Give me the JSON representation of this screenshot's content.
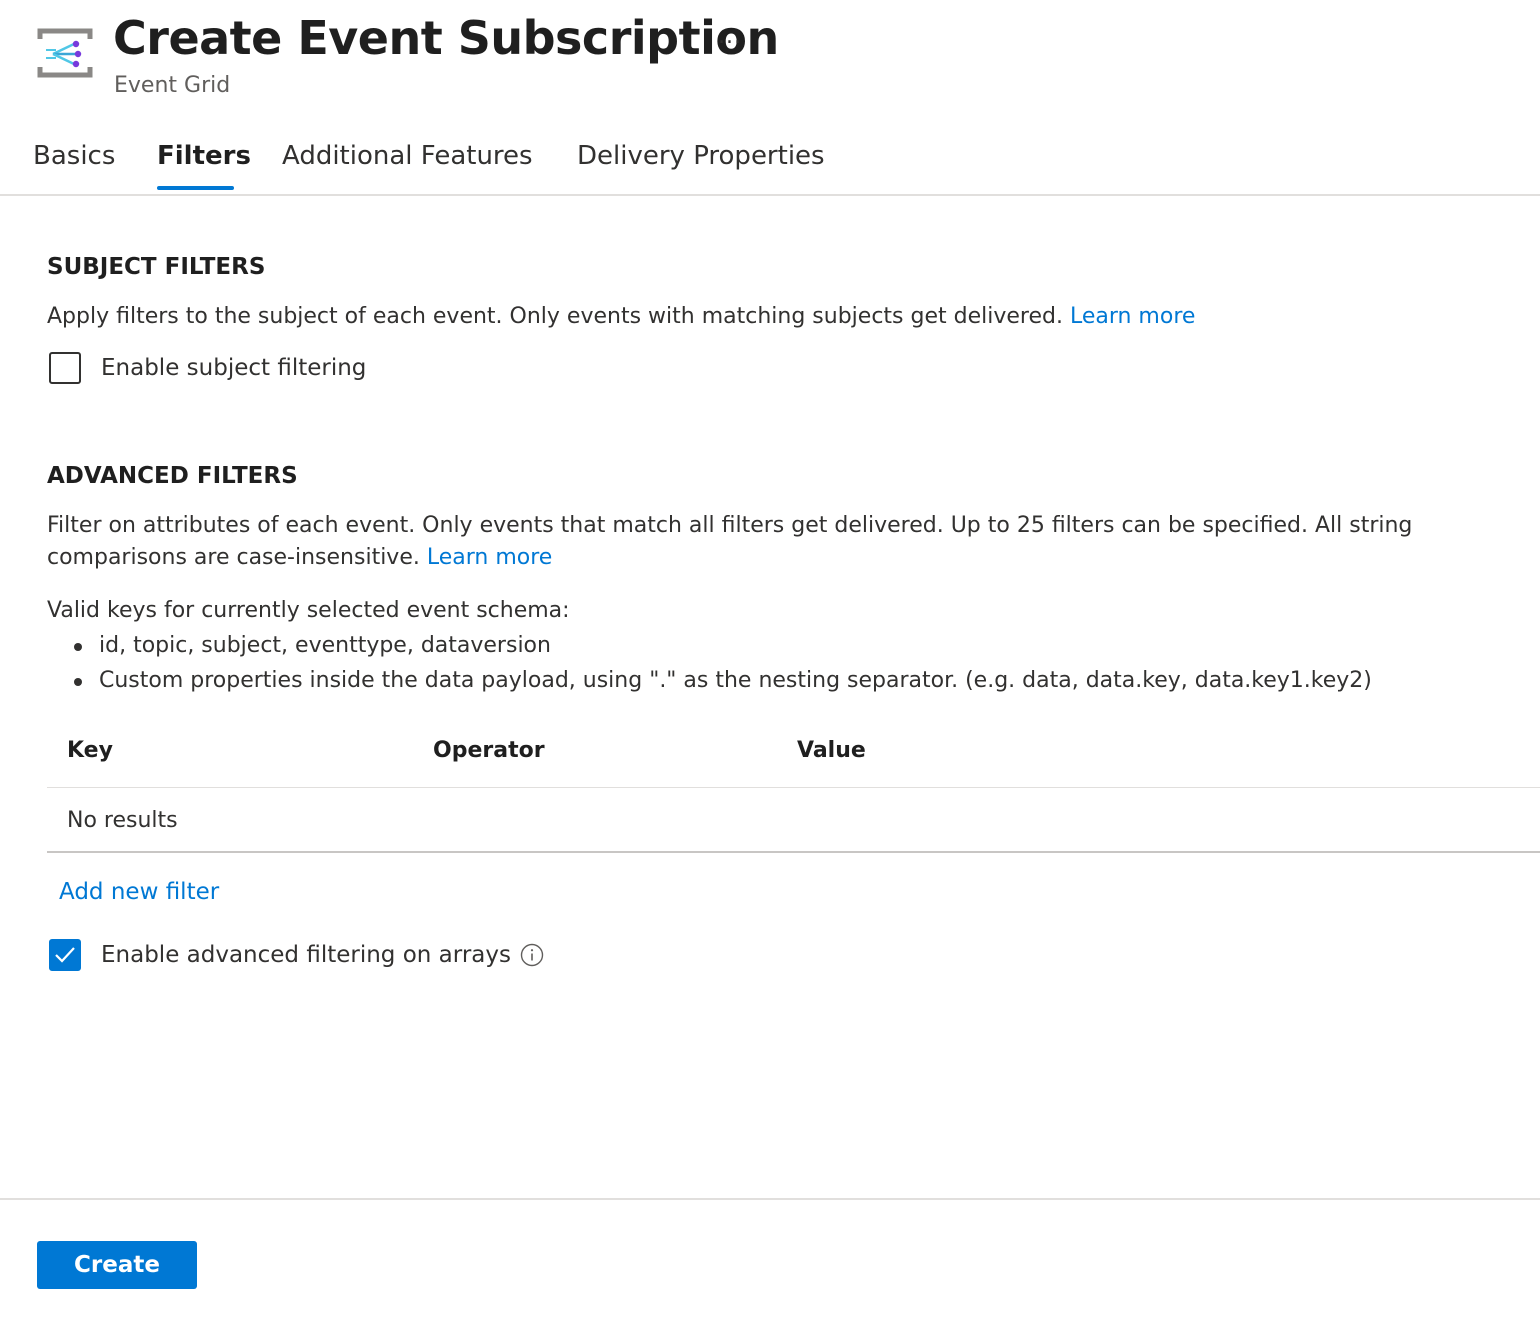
{
  "header": {
    "icon": "event-grid-icon",
    "title": "Create Event Subscription",
    "more_label": "...",
    "subtitle": "Event Grid"
  },
  "tabs": [
    {
      "label": "Basics",
      "active": false
    },
    {
      "label": "Filters",
      "active": true
    },
    {
      "label": "Additional Features",
      "active": false
    },
    {
      "label": "Delivery Properties",
      "active": false
    }
  ],
  "subject_filters": {
    "title": "SUBJECT FILTERS",
    "description": "Apply filters to the subject of each event. Only events with matching subjects get delivered.",
    "learn_more": "Learn more",
    "checkbox_label": "Enable subject filtering",
    "checked": false
  },
  "advanced_filters": {
    "title": "ADVANCED FILTERS",
    "description": "Filter on attributes of each event. Only events that match all filters get delivered. Up to 25 filters can be specified. All string comparisons are case-insensitive.",
    "learn_more": "Learn more",
    "valid_keys_label": "Valid keys for currently selected event schema:",
    "valid_keys": [
      "id, topic, subject, eventtype, dataversion",
      "Custom properties inside the data payload, using \".\" as the nesting separator. (e.g. data, data.key, data.key1.key2)"
    ],
    "table": {
      "columns": [
        "Key",
        "Operator",
        "Value"
      ],
      "empty_text": "No results"
    },
    "add_filter": "Add new filter",
    "arrays_checkbox_label": "Enable advanced filtering on arrays",
    "arrays_checked": true,
    "info_icon": "info-icon"
  },
  "footer": {
    "create_label": "Create"
  },
  "colors": {
    "accent": "#0078d4",
    "text": "#323130",
    "divider": "#e1dfdd"
  }
}
